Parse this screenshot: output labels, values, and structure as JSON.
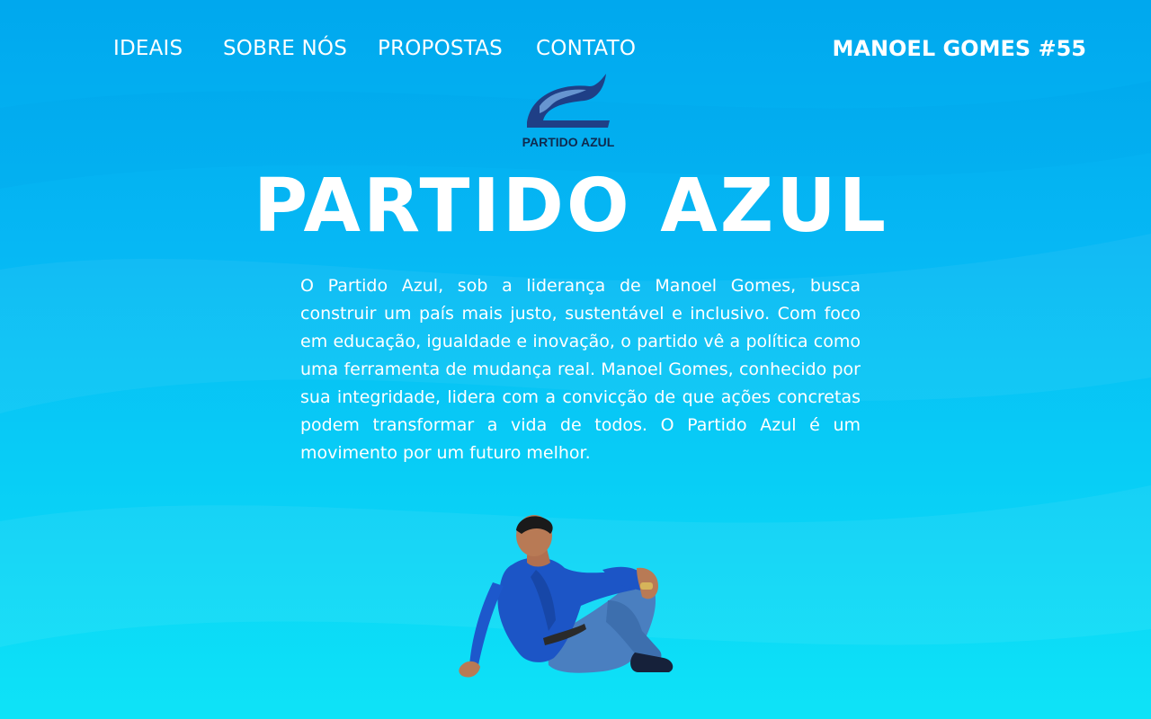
{
  "nav": {
    "links": [
      "IDEAIS",
      "SOBRE NÓS",
      "PROPOSTAS",
      "CONTATO"
    ],
    "brand": "MANOEL GOMES #55"
  },
  "logo": {
    "text": "PARTIDO AZUL",
    "icon": "wave-logo-icon",
    "colors": {
      "wave": "#1f3f86",
      "wave_light": "#6f9fd8",
      "text": "#0f2a4f"
    }
  },
  "hero": {
    "title": "PARTIDO AZUL",
    "body": "O Partido Azul, sob a liderança de Manoel Gomes, busca construir um país mais justo, sustentável e inclusivo. Com foco em educação, igualdade e inovação, o partido vê a política como uma ferramenta de mudança real. Manoel Gomes, conhecido por sua integridade, lidera com a convicção de que ações concretas podem transformar a vida de todos. O Partido Azul é um movimento por um futuro melhor."
  },
  "portrait": {
    "icon": "candidate-photo"
  },
  "colors": {
    "background_top": "#00a8ee",
    "background_bottom": "#0ee3f7",
    "text": "#ffffff"
  }
}
